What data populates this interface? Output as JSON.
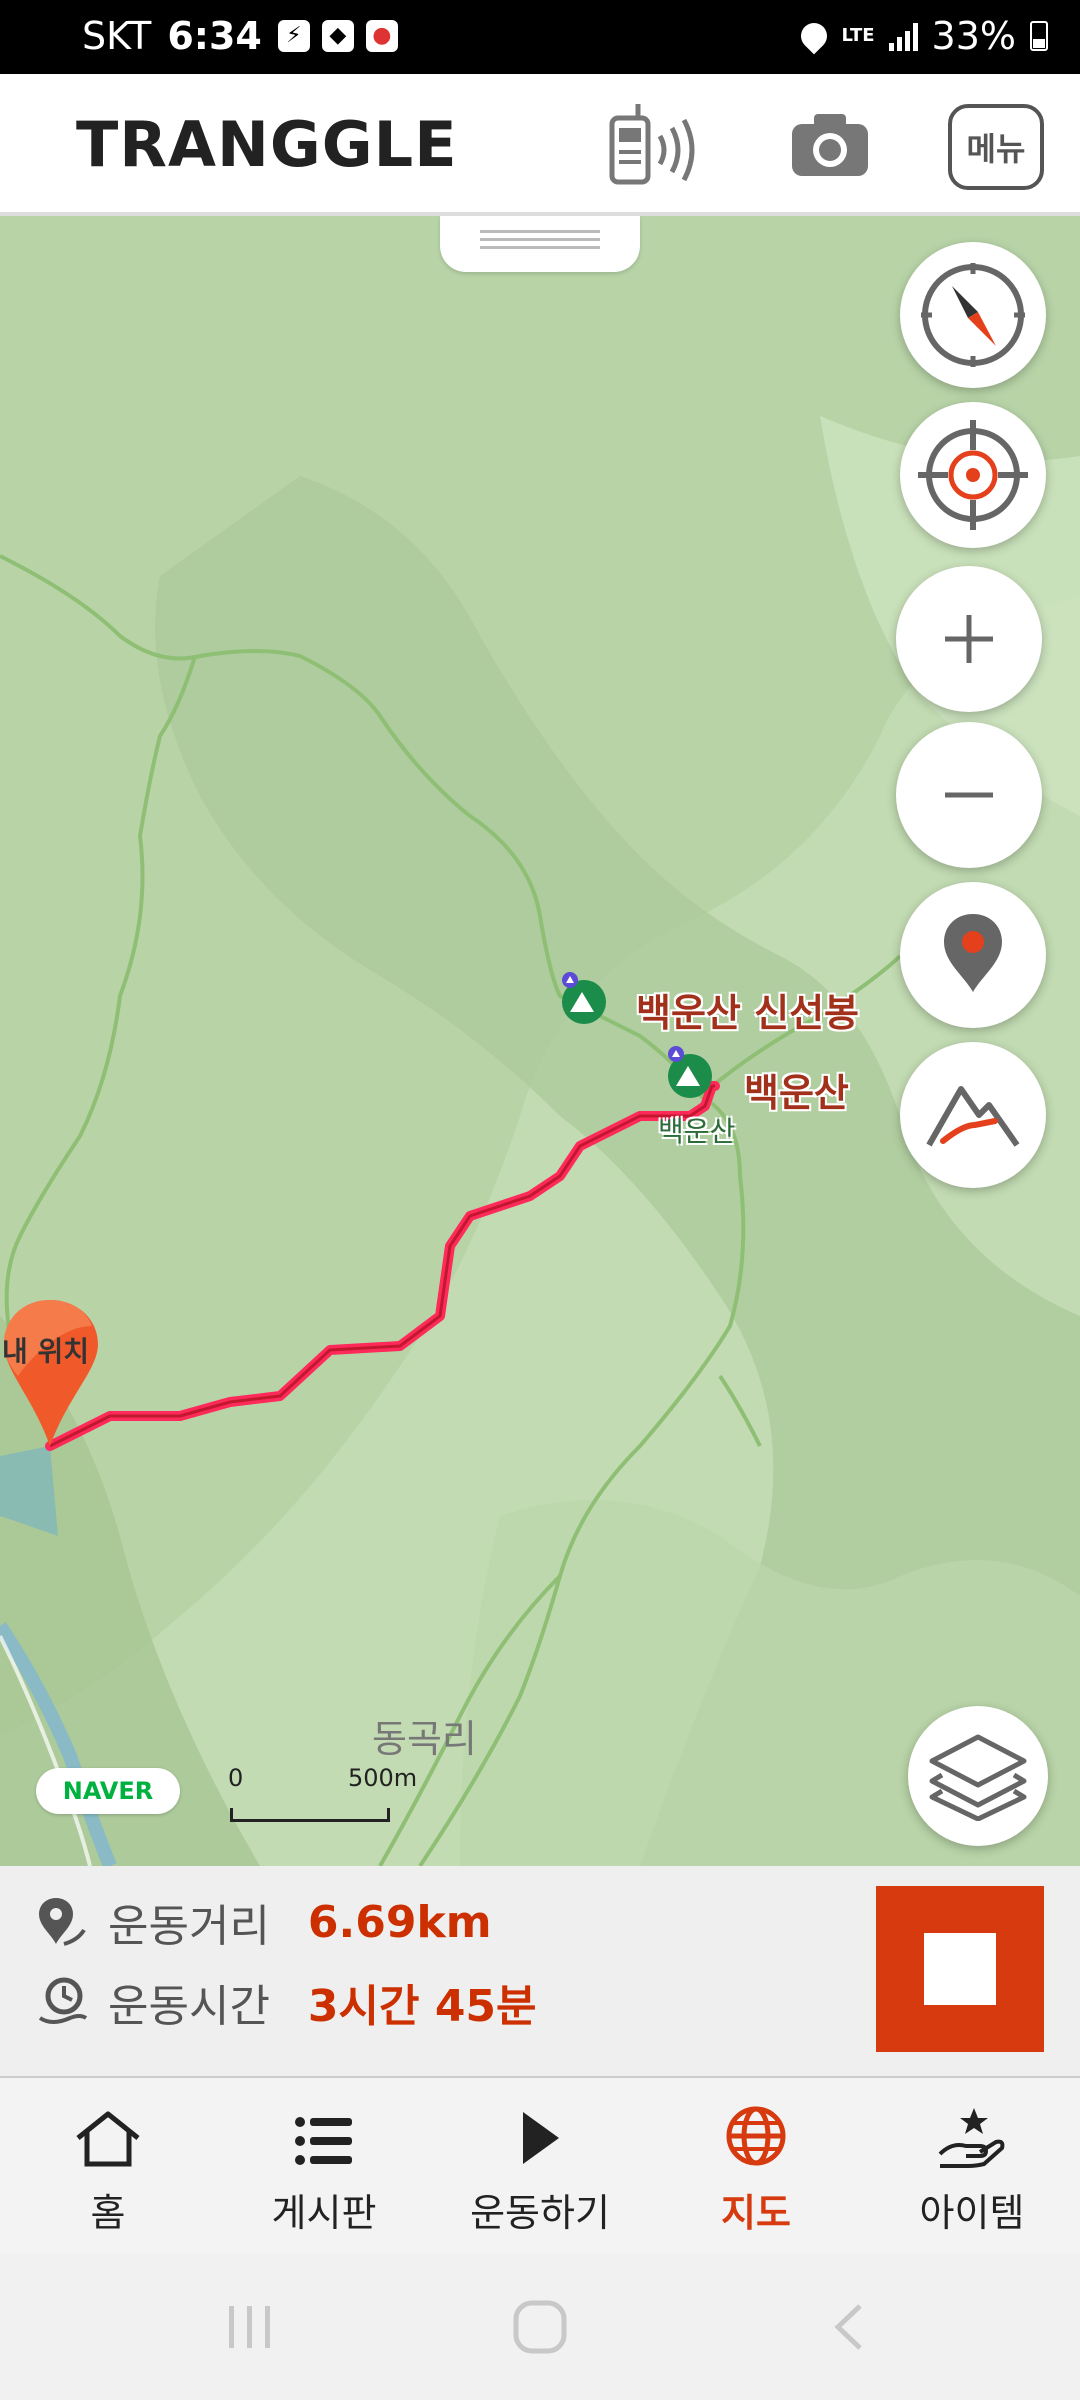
{
  "status_bar": {
    "carrier": "SKT",
    "time": "6:34",
    "network": "LTE",
    "battery": "33%"
  },
  "header": {
    "logo": "TRANGGLE",
    "menu_label": "메뉴"
  },
  "map": {
    "peaks": [
      {
        "name": "백운산 신선봉"
      },
      {
        "name": "백운산"
      }
    ],
    "peak_small_label": "백운산",
    "village_label": "동곡리",
    "my_location_label": "내 위치",
    "provider": "NAVER",
    "scale": {
      "start": "0",
      "end": "500m"
    }
  },
  "stats": {
    "distance_label": "운동거리",
    "distance_value": "6.69km",
    "time_label": "운동시간",
    "time_value": "3시간 45분"
  },
  "nav": {
    "items": [
      {
        "label": "홈",
        "icon": "home-icon"
      },
      {
        "label": "게시판",
        "icon": "list-icon"
      },
      {
        "label": "운동하기",
        "icon": "play-icon"
      },
      {
        "label": "지도",
        "icon": "globe-icon",
        "active": true
      },
      {
        "label": "아이템",
        "icon": "item-hand-icon"
      }
    ]
  },
  "colors": {
    "accent": "#d63a0e",
    "route": "#ff2a5a",
    "map_green": "#b8d4a8"
  }
}
